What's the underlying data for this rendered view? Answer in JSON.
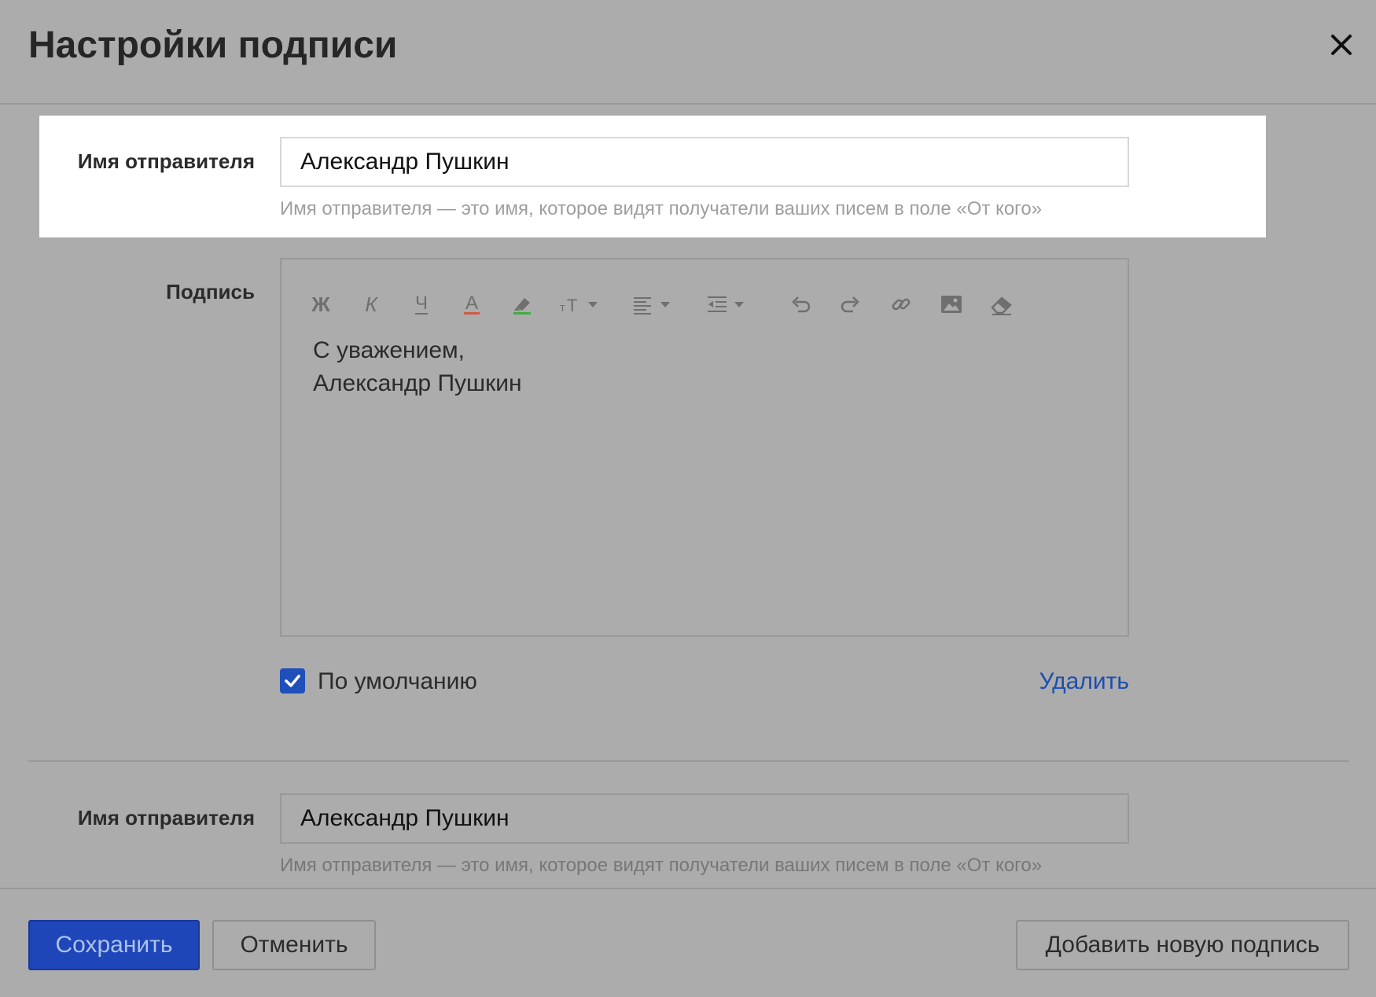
{
  "dialog": {
    "title": "Настройки подписи",
    "close_icon": "close-icon"
  },
  "signatures": [
    {
      "sender_label": "Имя отправителя",
      "sender_value": "Александр Пушкин",
      "sender_hint": "Имя отправителя — это имя, которое видят получатели ваших писем в поле «От кого»",
      "signature_label": "Подпись",
      "toolbar": [
        {
          "name": "bold-icon",
          "glyph": "Ж"
        },
        {
          "name": "italic-icon",
          "glyph": "К"
        },
        {
          "name": "underline-icon",
          "glyph": "Ч"
        },
        {
          "name": "text-color-icon",
          "glyph": "A"
        },
        {
          "name": "highlight-color-icon",
          "glyph": "marker"
        },
        {
          "name": "font-size-icon",
          "glyph": "тТ"
        },
        {
          "name": "align-icon",
          "glyph": "align"
        },
        {
          "name": "indent-icon",
          "glyph": "indent"
        },
        {
          "name": "undo-icon",
          "glyph": "undo"
        },
        {
          "name": "redo-icon",
          "glyph": "redo"
        },
        {
          "name": "link-icon",
          "glyph": "link"
        },
        {
          "name": "image-icon",
          "glyph": "image"
        },
        {
          "name": "eraser-icon",
          "glyph": "eraser"
        }
      ],
      "body_lines": [
        "С уважением,",
        "Александр Пушкин"
      ],
      "default_checked": true,
      "default_label": "По умолчанию",
      "delete_label": "Удалить"
    },
    {
      "sender_label": "Имя отправителя",
      "sender_value": "Александр Пушкин",
      "sender_hint": "Имя отправителя — это имя, которое видят получатели ваших писем в поле «От кого»"
    }
  ],
  "footer": {
    "save_label": "Сохранить",
    "cancel_label": "Отменить",
    "add_label": "Добавить новую подпись"
  },
  "colors": {
    "overlay": "#acacac",
    "accent": "#1e46b8",
    "link": "#1c4fae",
    "text_color_underline": "#d05a4a",
    "highlight_underline": "#3fae3f"
  }
}
